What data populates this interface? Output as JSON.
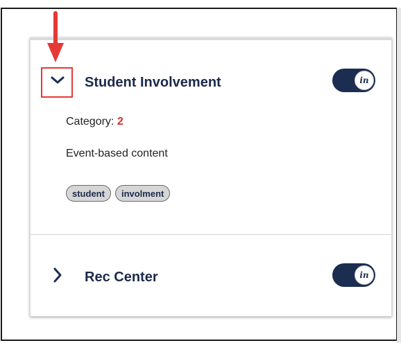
{
  "colors": {
    "navy": "#1c2d52",
    "accent_red": "#e53935",
    "category_number": "#d32f2f"
  },
  "items": [
    {
      "title": "Student Involvement",
      "expanded": true,
      "toggle_label": "in",
      "category_label": "Category:",
      "category_value": "2",
      "description": "Event-based content",
      "tags": [
        "student",
        "involment"
      ]
    },
    {
      "title": "Rec Center",
      "expanded": false,
      "toggle_label": "in"
    }
  ],
  "annotation": {
    "icon": "red-arrow-down-icon"
  }
}
